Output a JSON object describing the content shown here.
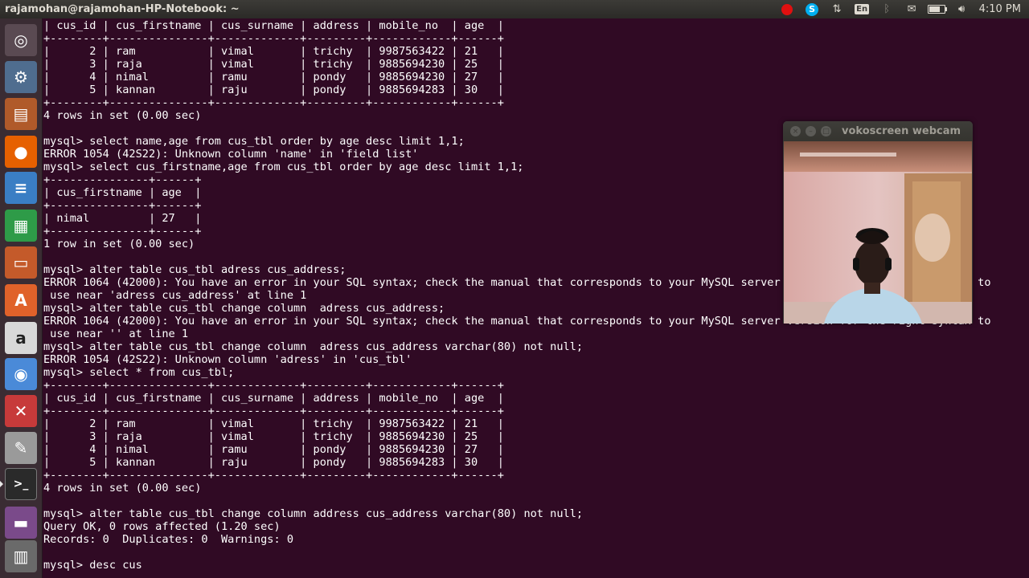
{
  "top_panel": {
    "title": "rajamohan@rajamohan-HP-Notebook: ~",
    "clock": "4:10 PM",
    "language": "En",
    "icons": [
      "record-icon",
      "skype-icon",
      "network-icon",
      "keyboard-language-icon",
      "bluetooth-icon",
      "mail-icon",
      "battery-icon",
      "volume-icon"
    ],
    "battery_level": 0.7
  },
  "launcher": {
    "items": [
      {
        "name": "dash-home-icon",
        "bg": "#5a4a52",
        "glyph": "◎"
      },
      {
        "name": "system-settings-icon",
        "bg": "#4f6d8f",
        "glyph": "⚙"
      },
      {
        "name": "files-icon",
        "bg": "#b05a2a",
        "glyph": "▤"
      },
      {
        "name": "firefox-icon",
        "bg": "#e66000",
        "glyph": "●"
      },
      {
        "name": "writer-icon",
        "bg": "#3a7ec4",
        "glyph": "≡"
      },
      {
        "name": "calc-icon",
        "bg": "#2e9b48",
        "glyph": "▦"
      },
      {
        "name": "impress-icon",
        "bg": "#c45a2a",
        "glyph": "▭"
      },
      {
        "name": "software-center-icon",
        "bg": "#e0622a",
        "glyph": "A"
      },
      {
        "name": "amazon-icon",
        "bg": "#d8d8d8",
        "glyph": "a"
      },
      {
        "name": "chromium-icon",
        "bg": "#4a8ad8",
        "glyph": "◉"
      },
      {
        "name": "tools-icon",
        "bg": "#c73a3a",
        "glyph": "✕"
      },
      {
        "name": "text-editor-icon",
        "bg": "#9a9a9a",
        "glyph": "✎"
      },
      {
        "name": "terminal-icon",
        "bg": "#2a2a2a",
        "glyph": ">_"
      },
      {
        "name": "workspace-switcher-icon",
        "bg": "#7a4a8a",
        "glyph": "▬"
      },
      {
        "name": "trash-icon",
        "bg": "#6a6a6a",
        "glyph": "▥"
      }
    ]
  },
  "terminal": {
    "lines": [
      "| cus_id | cus_firstname | cus_surname | address | mobile_no  | age  |",
      "+--------+---------------+-------------+---------+------------+------+",
      "|      2 | ram           | vimal       | trichy  | 9987563422 | 21   |",
      "|      3 | raja          | vimal       | trichy  | 9885694230 | 25   |",
      "|      4 | nimal         | ramu        | pondy   | 9885694230 | 27   |",
      "|      5 | kannan        | raju        | pondy   | 9885694283 | 30   |",
      "+--------+---------------+-------------+---------+------------+------+",
      "4 rows in set (0.00 sec)",
      "",
      "mysql> select name,age from cus_tbl order by age desc limit 1,1;",
      "ERROR 1054 (42S22): Unknown column 'name' in 'field list'",
      "mysql> select cus_firstname,age from cus_tbl order by age desc limit 1,1;",
      "+---------------+------+",
      "| cus_firstname | age  |",
      "+---------------+------+",
      "| nimal         | 27   |",
      "+---------------+------+",
      "1 row in set (0.00 sec)",
      "",
      "mysql> alter table cus_tbl adress cus_address;",
      "ERROR 1064 (42000): You have an error in your SQL syntax; check the manual that corresponds to your MySQL server version for the right syntax to",
      " use near 'adress cus_address' at line 1",
      "mysql> alter table cus_tbl change column  adress cus_address;",
      "ERROR 1064 (42000): You have an error in your SQL syntax; check the manual that corresponds to your MySQL server version for the right syntax to",
      " use near '' at line 1",
      "mysql> alter table cus_tbl change column  adress cus_address varchar(80) not null;",
      "ERROR 1054 (42S22): Unknown column 'adress' in 'cus_tbl'",
      "mysql> select * from cus_tbl;",
      "+--------+---------------+-------------+---------+------------+------+",
      "| cus_id | cus_firstname | cus_surname | address | mobile_no  | age  |",
      "+--------+---------------+-------------+---------+------------+------+",
      "|      2 | ram           | vimal       | trichy  | 9987563422 | 21   |",
      "|      3 | raja          | vimal       | trichy  | 9885694230 | 25   |",
      "|      4 | nimal         | ramu        | pondy   | 9885694230 | 27   |",
      "|      5 | kannan        | raju        | pondy   | 9885694283 | 30   |",
      "+--------+---------------+-------------+---------+------------+------+",
      "4 rows in set (0.00 sec)",
      "",
      "mysql> alter table cus_tbl change column address cus_address varchar(80) not null;",
      "Query OK, 0 rows affected (1.20 sec)",
      "Records: 0  Duplicates: 0  Warnings: 0",
      "",
      "mysql> desc cus"
    ]
  },
  "webcam": {
    "title": "vokoscreen webcam"
  }
}
